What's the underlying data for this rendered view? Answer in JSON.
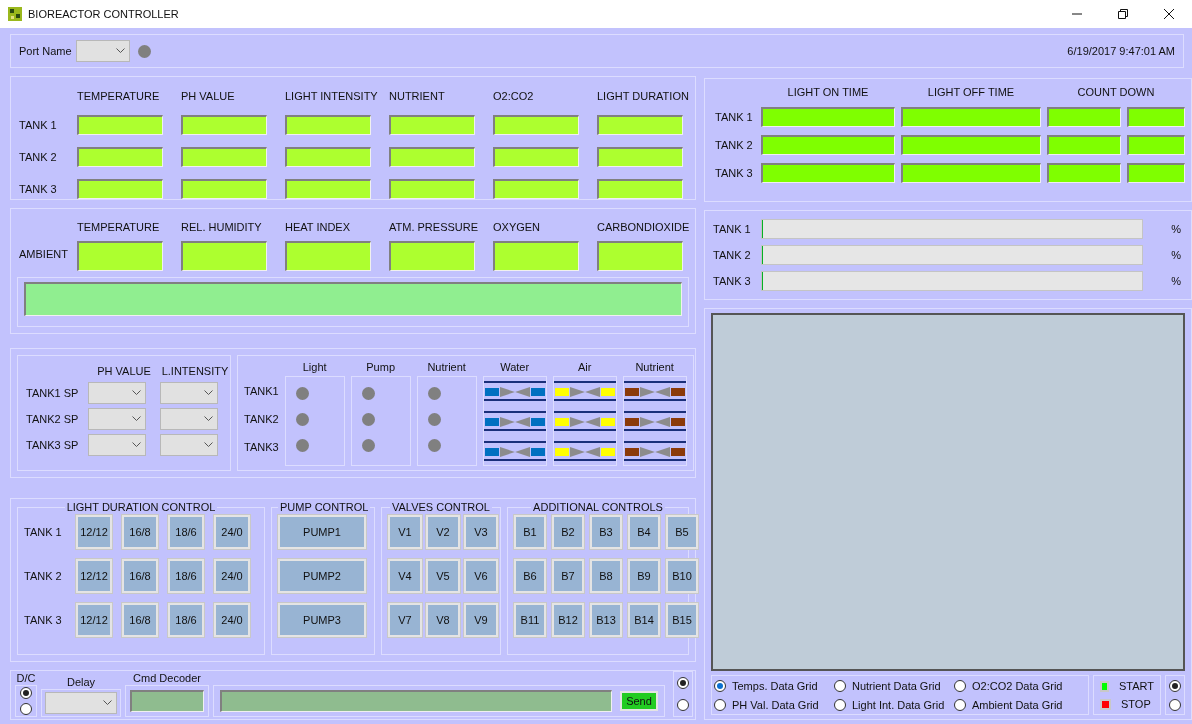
{
  "window": {
    "title": "BIOREACTOR CONTROLLER"
  },
  "port": {
    "label": "Port Name",
    "connected": false,
    "datetime": "6/19/2017 9:47:01 AM"
  },
  "tank_readings": {
    "columns": [
      "TEMPERATURE",
      "PH VALUE",
      "LIGHT INTENSITY",
      "NUTRIENT",
      "O2:CO2",
      "LIGHT DURATION"
    ],
    "rows": [
      "TANK 1",
      "TANK 2",
      "TANK 3"
    ]
  },
  "ambient": {
    "label": "AMBIENT",
    "columns": [
      "TEMPERATURE",
      "REL. HUMIDITY",
      "HEAT INDEX",
      "ATM. PRESSURE",
      "OXYGEN",
      "CARBONDIOXIDE"
    ]
  },
  "setpoints": {
    "columns": [
      "PH VALUE",
      "L.INTENSITY"
    ],
    "rows": [
      "TANK1 SP",
      "TANK2 SP",
      "TANK3 SP"
    ]
  },
  "indicators": {
    "columns": [
      "Light",
      "Pump",
      "Nutrient"
    ],
    "rows": [
      {
        "label": "TANK1",
        "lamps": [
          {
            "on": false
          },
          {
            "on": false
          },
          {
            "on": false
          }
        ]
      },
      {
        "label": "TANK2",
        "lamps": [
          {
            "on": false
          },
          {
            "on": false
          },
          {
            "on": false
          }
        ]
      },
      {
        "label": "TANK3",
        "lamps": [
          {
            "on": false
          },
          {
            "on": false
          },
          {
            "on": false
          }
        ]
      }
    ]
  },
  "valves": [
    {
      "label": "Water",
      "color": "#0070c0"
    },
    {
      "label": "Air",
      "color": "#ffff00"
    },
    {
      "label": "Nutrient",
      "color": "#8b3a0a"
    }
  ],
  "light_duration": {
    "title": "LIGHT DURATION CONTROL",
    "rows": [
      {
        "label": "TANK 1",
        "buttons": [
          "12/12",
          "16/8",
          "18/6",
          "24/0"
        ]
      },
      {
        "label": "TANK 2",
        "buttons": [
          "12/12",
          "16/8",
          "18/6",
          "24/0"
        ]
      },
      {
        "label": "TANK 3",
        "buttons": [
          "12/12",
          "16/8",
          "18/6",
          "24/0"
        ]
      }
    ]
  },
  "pump_control": {
    "title": "PUMP CONTROL",
    "buttons": [
      "PUMP1",
      "PUMP2",
      "PUMP3"
    ]
  },
  "valves_control": {
    "title": "VALVES CONTROL",
    "buttons": [
      "V1",
      "V2",
      "V3",
      "V4",
      "V5",
      "V6",
      "V7",
      "V8",
      "V9"
    ]
  },
  "additional_controls": {
    "title": "ADDITIONAL CONTROLS",
    "buttons": [
      "B1",
      "B2",
      "B3",
      "B4",
      "B5",
      "B6",
      "B7",
      "B8",
      "B9",
      "B10",
      "B11",
      "B12",
      "B13",
      "B14",
      "B15"
    ]
  },
  "command": {
    "dc_label": "D/C",
    "dc_options": [
      {
        "selected": true
      },
      {
        "selected": false
      }
    ],
    "delay_label": "Delay",
    "decoder_label": "Cmd Decoder",
    "send": "Send",
    "side_options": [
      {
        "selected": true
      },
      {
        "selected": false
      }
    ]
  },
  "light_schedule": {
    "columns": [
      "LIGHT ON TIME",
      "LIGHT OFF TIME",
      "COUNT DOWN"
    ],
    "rows": [
      "TANK 1",
      "TANK 2",
      "TANK 3"
    ]
  },
  "progress": [
    {
      "label": "TANK 1",
      "level": 0,
      "unit": "%"
    },
    {
      "label": "TANK 2",
      "level": 0,
      "unit": "%"
    },
    {
      "label": "TANK 3",
      "level": 0,
      "unit": "%"
    }
  ],
  "grid_options": [
    {
      "label": "Temps. Data Grid",
      "selected": true
    },
    {
      "label": "Nutrient Data Grid",
      "selected": false
    },
    {
      "label": "O2:CO2 Data Grid",
      "selected": false
    },
    {
      "label": "PH Val. Data Grid",
      "selected": false
    },
    {
      "label": "Light Int. Data Grid",
      "selected": false
    },
    {
      "label": "Ambient Data Grid",
      "selected": false
    }
  ],
  "run_controls": [
    {
      "label": "START",
      "color": "#00ff00"
    },
    {
      "label": "STOP",
      "color": "#ff0000"
    }
  ],
  "mode_options": [
    {
      "selected": true
    },
    {
      "selected": false
    }
  ]
}
